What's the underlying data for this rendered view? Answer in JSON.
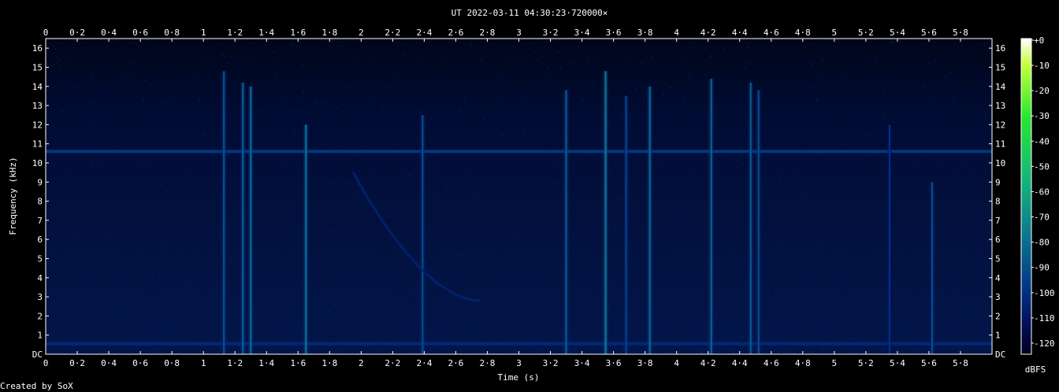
{
  "chart_data": {
    "type": "heatmap",
    "title": "UT 2022-03-11 04:30:23·720000×",
    "xlabel": "Time (s)",
    "ylabel": "Frequency (kHz)",
    "xlim": [
      0,
      6.0
    ],
    "ylim": [
      0,
      16.5
    ],
    "x_ticks": [
      "0",
      "0·2",
      "0·4",
      "0·6",
      "0·8",
      "1",
      "1·2",
      "1·4",
      "1·6",
      "1·8",
      "2",
      "2·2",
      "2·4",
      "2·6",
      "2·8",
      "3",
      "3·2",
      "3·4",
      "3·6",
      "3·8",
      "4",
      "4·2",
      "4·4",
      "4·6",
      "4·8",
      "5",
      "5·2",
      "5·4",
      "5·6",
      "5·8"
    ],
    "y_ticks": [
      "DC",
      "1",
      "2",
      "3",
      "4",
      "5",
      "6",
      "7",
      "8",
      "9",
      "10",
      "11",
      "12",
      "13",
      "14",
      "15",
      "16"
    ],
    "colorbar": {
      "label": "dBFS",
      "ticks": [
        "+0",
        "-10",
        "-20",
        "-30",
        "-40",
        "-50",
        "-60",
        "-70",
        "-80",
        "-90",
        "-100",
        "-110",
        "-120"
      ],
      "range": [
        -120,
        0
      ],
      "colors": [
        "#00001a",
        "#001060",
        "#003a8a",
        "#0c7890",
        "#14b57a",
        "#25e830",
        "#c8ff40",
        "#ffffff"
      ]
    },
    "background_color": "#010a30",
    "continuous_lines": [
      {
        "freq_khz": 10.6,
        "level_dbfs": -85
      },
      {
        "freq_khz": 0.55,
        "level_dbfs": -92
      }
    ],
    "transients": [
      {
        "t": 1.13,
        "f_max": 14.8,
        "level_dbfs": -78
      },
      {
        "t": 1.25,
        "f_max": 14.2,
        "level_dbfs": -75
      },
      {
        "t": 1.3,
        "f_max": 14.0,
        "level_dbfs": -72
      },
      {
        "t": 1.65,
        "f_max": 12.0,
        "level_dbfs": -70
      },
      {
        "t": 2.39,
        "f_max": 12.5,
        "level_dbfs": -80
      },
      {
        "t": 3.3,
        "f_max": 13.8,
        "level_dbfs": -76
      },
      {
        "t": 3.55,
        "f_max": 14.8,
        "level_dbfs": -68
      },
      {
        "t": 3.68,
        "f_max": 13.5,
        "level_dbfs": -82
      },
      {
        "t": 3.83,
        "f_max": 14.0,
        "level_dbfs": -72
      },
      {
        "t": 4.22,
        "f_max": 14.4,
        "level_dbfs": -74
      },
      {
        "t": 4.47,
        "f_max": 14.2,
        "level_dbfs": -76
      },
      {
        "t": 4.52,
        "f_max": 13.8,
        "level_dbfs": -80
      },
      {
        "t": 5.35,
        "f_max": 12.0,
        "level_dbfs": -88
      },
      {
        "t": 5.62,
        "f_max": 9.0,
        "level_dbfs": -80
      }
    ],
    "sweeps": [
      {
        "t_start": 1.95,
        "t_end": 2.75,
        "f_start": 9.5,
        "f_end": 2.8,
        "level_dbfs": -95
      }
    ],
    "footer": "Created by SoX"
  }
}
